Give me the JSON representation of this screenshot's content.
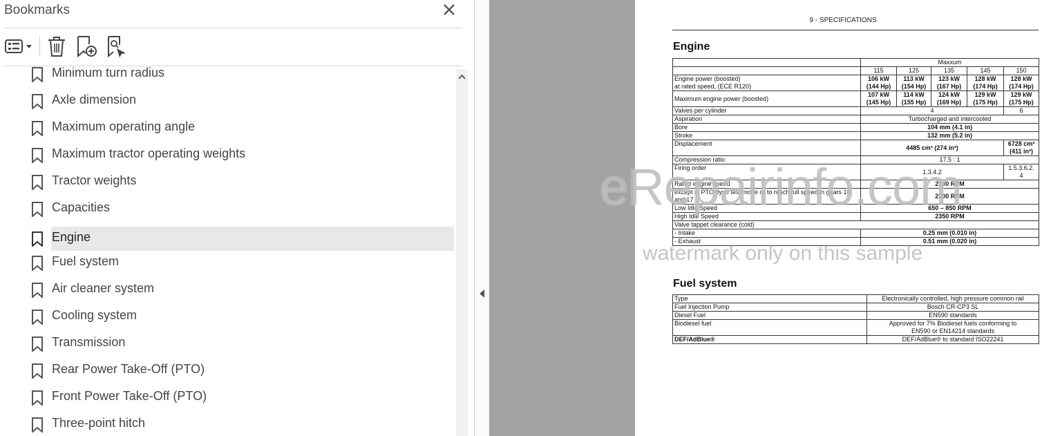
{
  "panel": {
    "title": "Bookmarks",
    "toolbar": {
      "options_icon": "bookmark-options-icon",
      "delete_icon": "trash-icon",
      "new_icon": "new-bookmark-icon",
      "find_icon": "find-bookmark-icon"
    },
    "selected_index": 6,
    "items": [
      {
        "label": "Minimum turn radius"
      },
      {
        "label": "Axle dimension"
      },
      {
        "label": "Maximum operating angle"
      },
      {
        "label": "Maximum tractor operating weights"
      },
      {
        "label": "Tractor weights"
      },
      {
        "label": "Capacities"
      },
      {
        "label": "Engine"
      },
      {
        "label": "Fuel system"
      },
      {
        "label": "Air cleaner system"
      },
      {
        "label": "Cooling system"
      },
      {
        "label": "Transmission"
      },
      {
        "label": "Rear Power Take-Off (PTO)"
      },
      {
        "label": "Front Power Take-Off (PTO)"
      },
      {
        "label": "Three-point hitch"
      }
    ]
  },
  "document": {
    "header": "9 - SPECIFICATIONS",
    "engine": {
      "title": "Engine",
      "model_header": "Maxxum",
      "models": [
        "115",
        "125",
        "135",
        "145",
        "150"
      ],
      "power_label1": "Engine power (boosted)",
      "power_label2": "at rated speed, (ECE R120)",
      "power": [
        [
          "106 kW",
          "(144 Hp)"
        ],
        [
          "113 kW",
          "(154 Hp)"
        ],
        [
          "123 kW",
          "(167 Hp)"
        ],
        [
          "128 kW",
          "(174 Hp)"
        ],
        [
          "128 kW",
          "(174 Hp)"
        ]
      ],
      "max_power_label": "Maximum engine power (boosted)",
      "max_power": [
        [
          "107 kW",
          "(145 Hp)"
        ],
        [
          "114 kW",
          "(155 Hp)"
        ],
        [
          "124 kW",
          "(169 Hp)"
        ],
        [
          "129 kW",
          "(175 Hp)"
        ],
        [
          "129 kW",
          "(175 Hp)"
        ]
      ],
      "valves_label": "Valves per cylinder",
      "valves_a": "4",
      "valves_b": "6",
      "aspiration_label": "Aspiration",
      "aspiration": "Turbocharged and intercooled",
      "bore_label": "Bore",
      "bore": "104 mm (4.1 in)",
      "stroke_label": "Stroke",
      "stroke": "132 mm (5.2 in)",
      "displacement_label": "Displacement",
      "displacement_a": "4485 cm³ (274 in³)",
      "displacement_b1": "6728 cm³",
      "displacement_b2": "(411 in³)",
      "compression_label": "Compression ratio",
      "compression": "17.5 : 1",
      "firing_label": "Firing order",
      "firing_a": "1.3.4.2",
      "firing_b1": "1.5.3.6.2.",
      "firing_b2": "4",
      "rated_speed_label": "Rated engine speed",
      "rated_speed": "2100 RPM",
      "pto_label": "except in PTO dyno test mode or to reach full speed in gears 16 and 17",
      "pto": "2200 RPM",
      "low_idle_label": "Low Idle Speed",
      "low_idle": "650 – 850 RPM",
      "high_idle_label": "High Idle Speed",
      "high_idle": "2350 RPM",
      "tappet_label": "Valve tappet clearance (cold)",
      "intake_label": "- Intake",
      "intake": "0.25 mm (0.010 in)",
      "exhaust_label": "- Exhaust",
      "exhaust": "0.51 mm (0.020 in)"
    },
    "fuel": {
      "title": "Fuel system",
      "type_label": "Type",
      "type": "Electronically controlled, high pressure common rail",
      "pump_label": "Fuel Injection Pump",
      "pump": "Bosch CR-CP3 SL",
      "diesel_label": "Diesel Fuel",
      "diesel": "EN590 standards",
      "biodiesel_label": "Biodiesel fuel",
      "biodiesel1": "Approved for 7% Biodiesel fuels conforming to",
      "biodiesel2": "EN590 or EN14214 standards",
      "def_label": "DEF/AdBlue®",
      "def": "DEF/AdBlue® to standard ISO22241"
    }
  },
  "watermark": {
    "main": "eRepairinfo.com",
    "sub": "watermark only on this sample"
  }
}
